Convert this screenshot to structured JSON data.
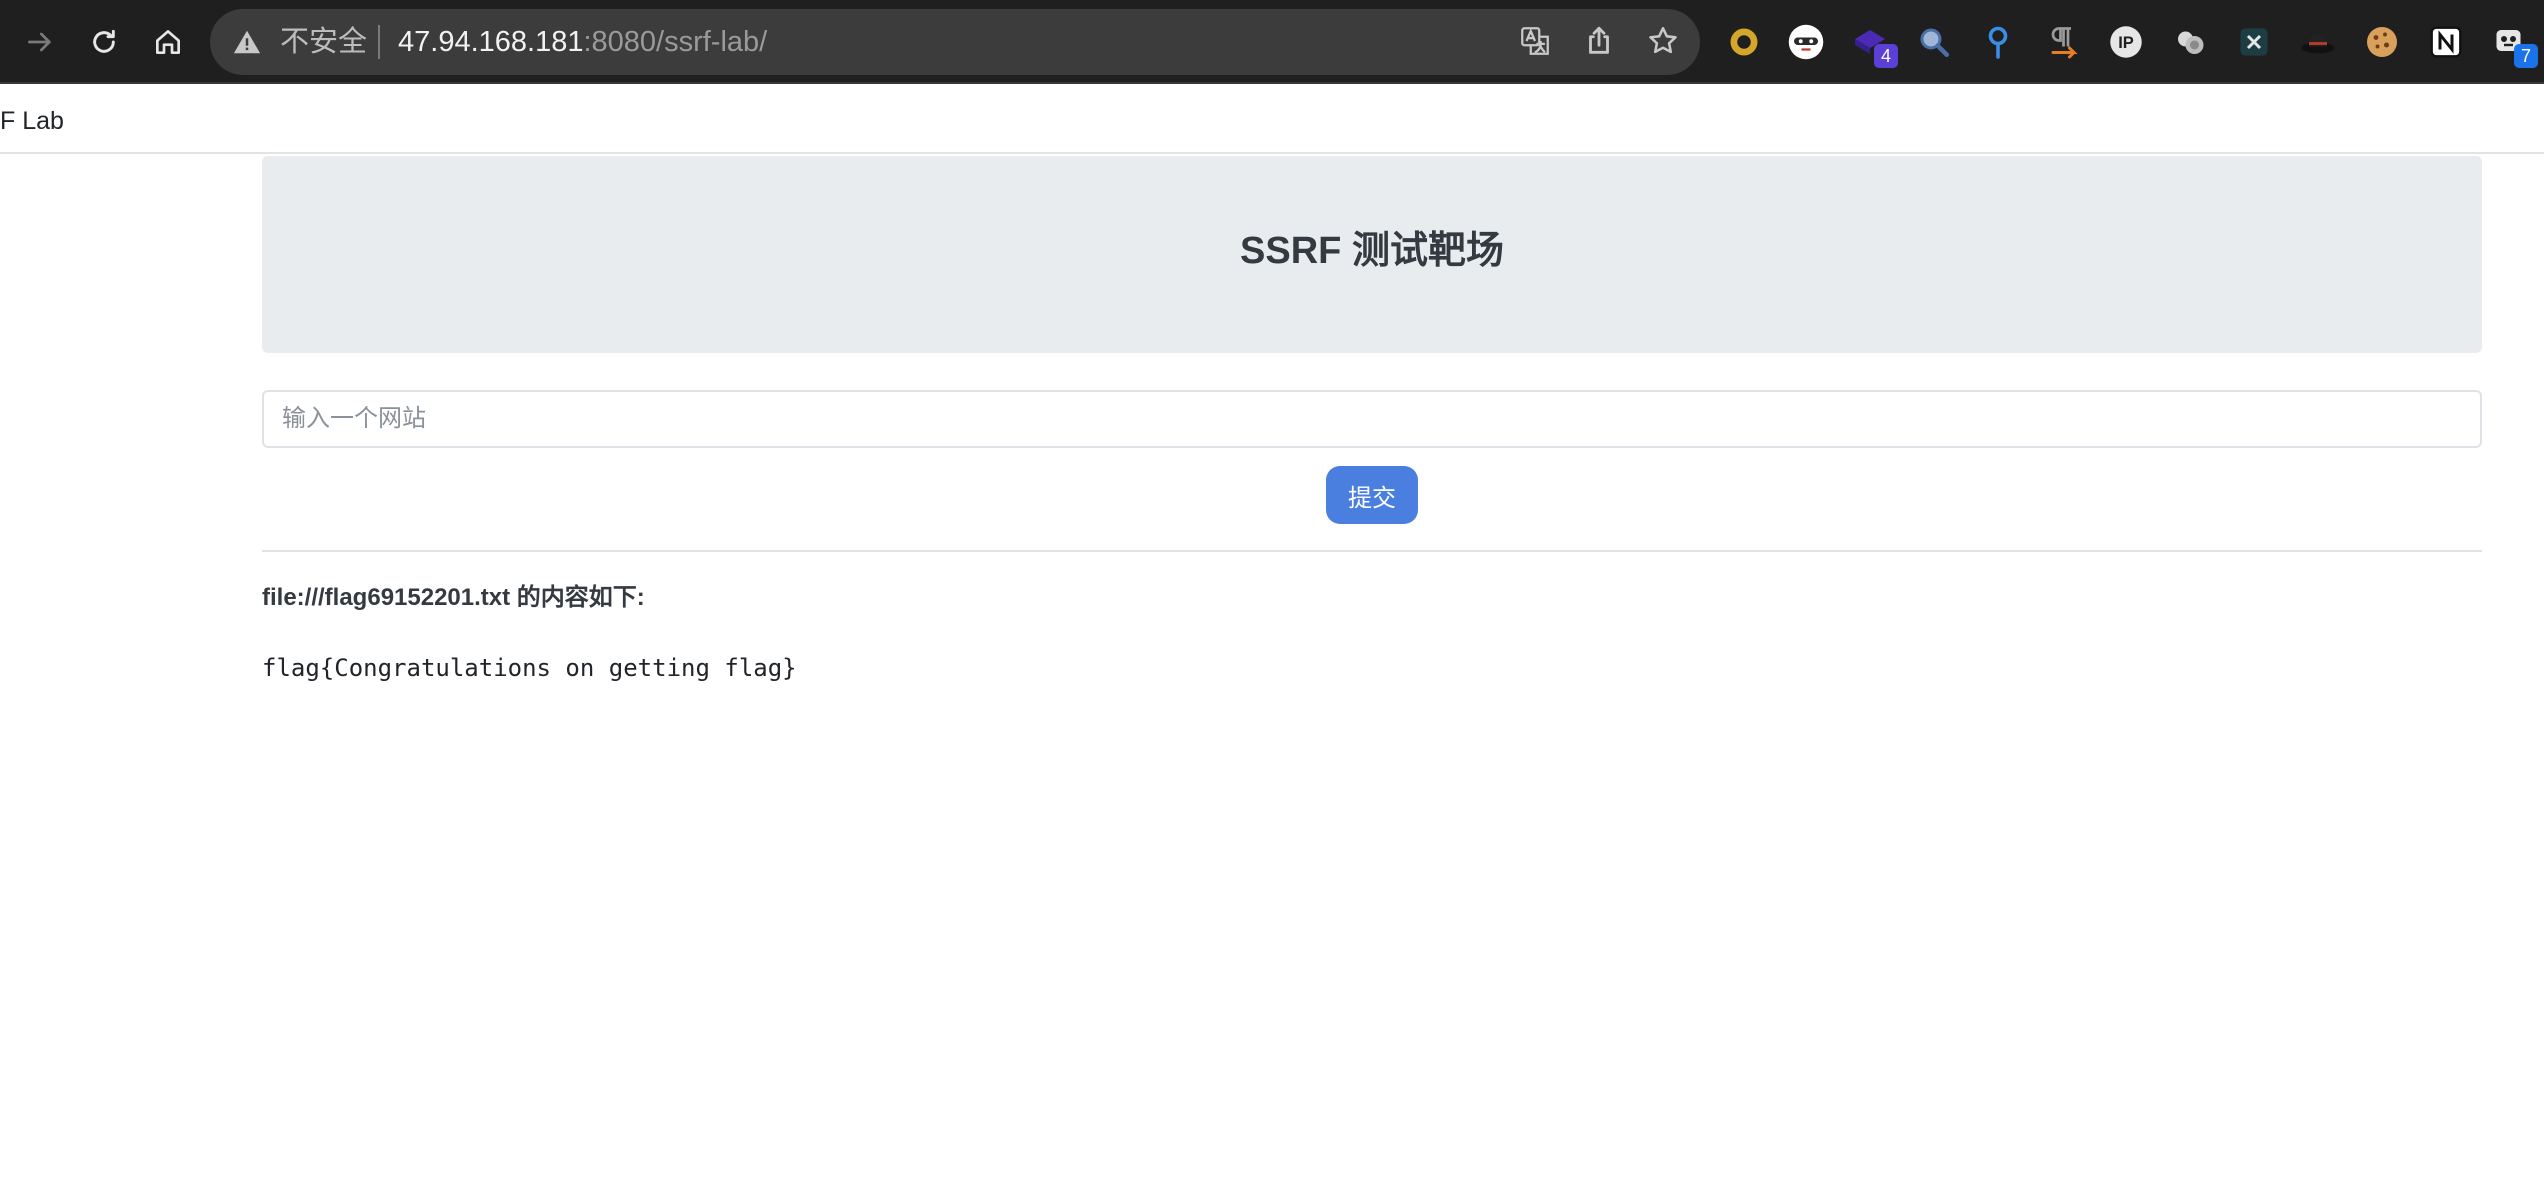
{
  "browser": {
    "security_label": "不安全",
    "url_host": "47.94.168.181",
    "url_rest": ":8080/ssrf-lab/",
    "extensions": [
      {
        "icon": "yellow-ring-icon"
      },
      {
        "icon": "masked-face-icon"
      },
      {
        "icon": "purple-gem-icon",
        "badge": "4"
      },
      {
        "icon": "magnifier-icon"
      },
      {
        "icon": "pin-icon"
      },
      {
        "icon": "pilcrow-arrow-icon"
      },
      {
        "icon": "ip-icon"
      },
      {
        "icon": "bubbles-icon"
      },
      {
        "icon": "x-box-icon"
      },
      {
        "icon": "hat-icon"
      },
      {
        "icon": "cookie-icon"
      },
      {
        "icon": "notion-icon"
      },
      {
        "icon": "robot-icon",
        "badge": "7"
      }
    ],
    "colors": {
      "toolbar": "#1f1f1f",
      "omnibox": "#3c3c3c",
      "badge_purple": "#5b3fd6",
      "badge_blue": "#1a73e8"
    }
  },
  "page": {
    "brand": "F Lab",
    "hero_title": "SSRF 测试靶场",
    "input_placeholder": "输入一个网站",
    "submit_label": "提交",
    "result_heading": "file:///flag69152201.txt 的内容如下:",
    "result_content": "flag{Congratulations on getting flag}",
    "colors": {
      "hero_bg": "#e9ecef",
      "button": "#4a7fe0"
    }
  }
}
